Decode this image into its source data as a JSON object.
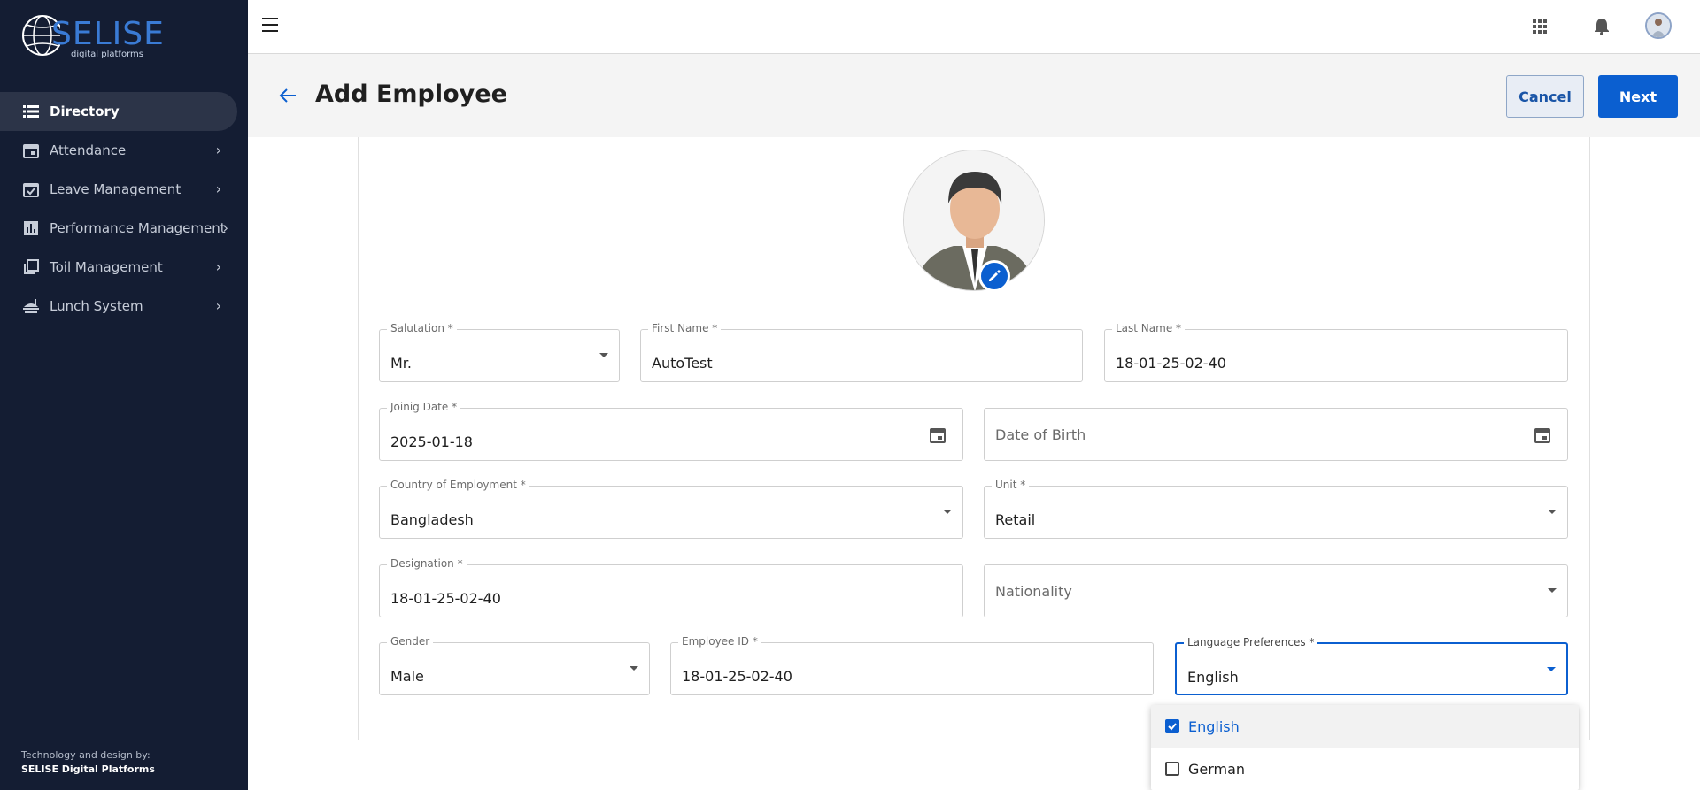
{
  "brand": {
    "logo_text": "SELISE",
    "logo_subtext": "digital platforms",
    "credit_label": "Technology and design by:",
    "credit_company": "SELISE Digital Platforms"
  },
  "sidebar": {
    "items": [
      {
        "label": "Directory",
        "icon": "list-icon",
        "active": true
      },
      {
        "label": "Attendance",
        "icon": "calendar-icon"
      },
      {
        "label": "Leave Management",
        "icon": "calendar-check-icon"
      },
      {
        "label": "Performance Management",
        "icon": "bar-chart-icon"
      },
      {
        "label": "Toil Management",
        "icon": "library-icon"
      },
      {
        "label": "Lunch System",
        "icon": "food-icon"
      }
    ]
  },
  "header": {
    "title": "Add Employee",
    "cancel_label": "Cancel",
    "next_label": "Next"
  },
  "form": {
    "salutation": {
      "label": "Salutation *",
      "value": "Mr."
    },
    "first_name": {
      "label": "First Name *",
      "value": "AutoTest"
    },
    "last_name": {
      "label": "Last Name *",
      "value": "18-01-25-02-40"
    },
    "joining_date": {
      "label": "Joinig Date *",
      "value": "2025-01-18"
    },
    "date_of_birth": {
      "placeholder": "Date of Birth"
    },
    "country": {
      "label": "Country of Employment *",
      "value": "Bangladesh"
    },
    "unit": {
      "label": "Unit *",
      "value": "Retail"
    },
    "designation": {
      "label": "Designation *",
      "value": "18-01-25-02-40"
    },
    "nationality": {
      "placeholder": "Nationality"
    },
    "gender": {
      "label": "Gender",
      "value": "Male"
    },
    "employee_id": {
      "label": "Employee ID *",
      "value": "18-01-25-02-40"
    },
    "language": {
      "label": "Language Preferences *",
      "value": "English"
    }
  },
  "language_menu": {
    "options": [
      {
        "label": "English",
        "checked": true
      },
      {
        "label": "German",
        "checked": false
      }
    ]
  },
  "colors": {
    "sidebar_bg": "#141d33",
    "primary": "#0b5fd0",
    "header_band": "#f4f4f4"
  }
}
